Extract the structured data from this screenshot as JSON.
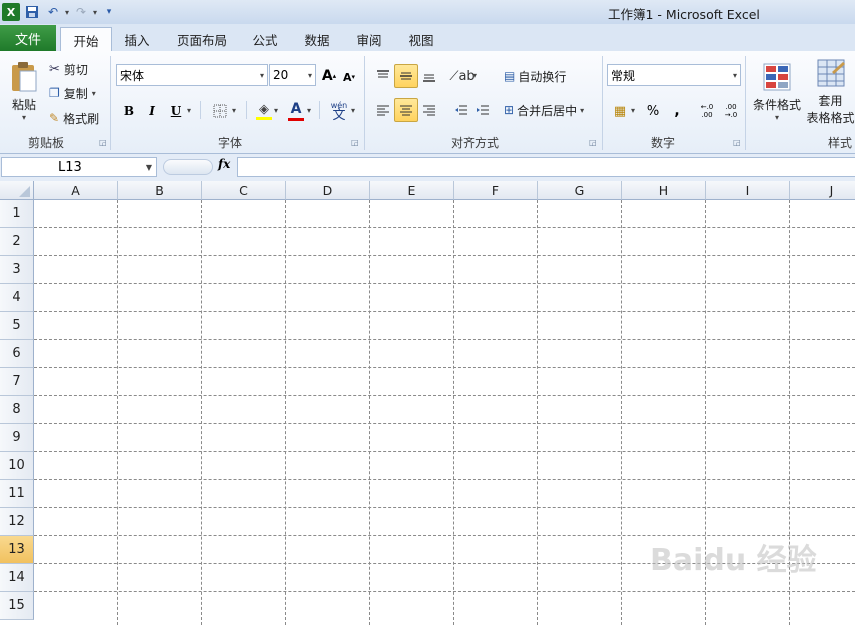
{
  "app": {
    "title": "工作簿1 - Microsoft Excel"
  },
  "tabs": {
    "file": "文件",
    "home": "开始",
    "insert": "插入",
    "layout": "页面布局",
    "formulas": "公式",
    "data": "数据",
    "review": "审阅",
    "view": "视图"
  },
  "clipboard": {
    "paste": "粘贴",
    "cut": "剪切",
    "copy": "复制",
    "format_painter": "格式刷",
    "group": "剪贴板"
  },
  "font": {
    "name": "宋体",
    "size": "20",
    "group": "字体",
    "bold": "B",
    "italic": "I",
    "underline": "U",
    "phonetic": "wén",
    "phonetic_char": "文"
  },
  "alignment": {
    "wrap": "自动换行",
    "merge": "合并后居中",
    "group": "对齐方式"
  },
  "number": {
    "format": "常规",
    "percent": "%",
    "comma": ",",
    "inc_decimal": "←.0 .00",
    "dec_decimal": ".00 →.0",
    "group": "数字"
  },
  "styles": {
    "conditional": "条件格式",
    "table_line1": "套用",
    "table_line2": "表格格式",
    "group": "样式"
  },
  "formula_bar": {
    "cell_ref": "L13",
    "fx": "fx"
  },
  "columns": [
    "A",
    "B",
    "C",
    "D",
    "E",
    "F",
    "G",
    "H",
    "I",
    "J"
  ],
  "rows": [
    "1",
    "2",
    "3",
    "4",
    "5",
    "6",
    "7",
    "8",
    "9",
    "10",
    "11",
    "12",
    "13",
    "14",
    "15"
  ],
  "selected_row": "13",
  "watermark": "Baidu 经验",
  "colors": {
    "file_tab": "#2e8b3a",
    "selected_header": "#f1c15f",
    "ribbon": "#e6eef8"
  }
}
